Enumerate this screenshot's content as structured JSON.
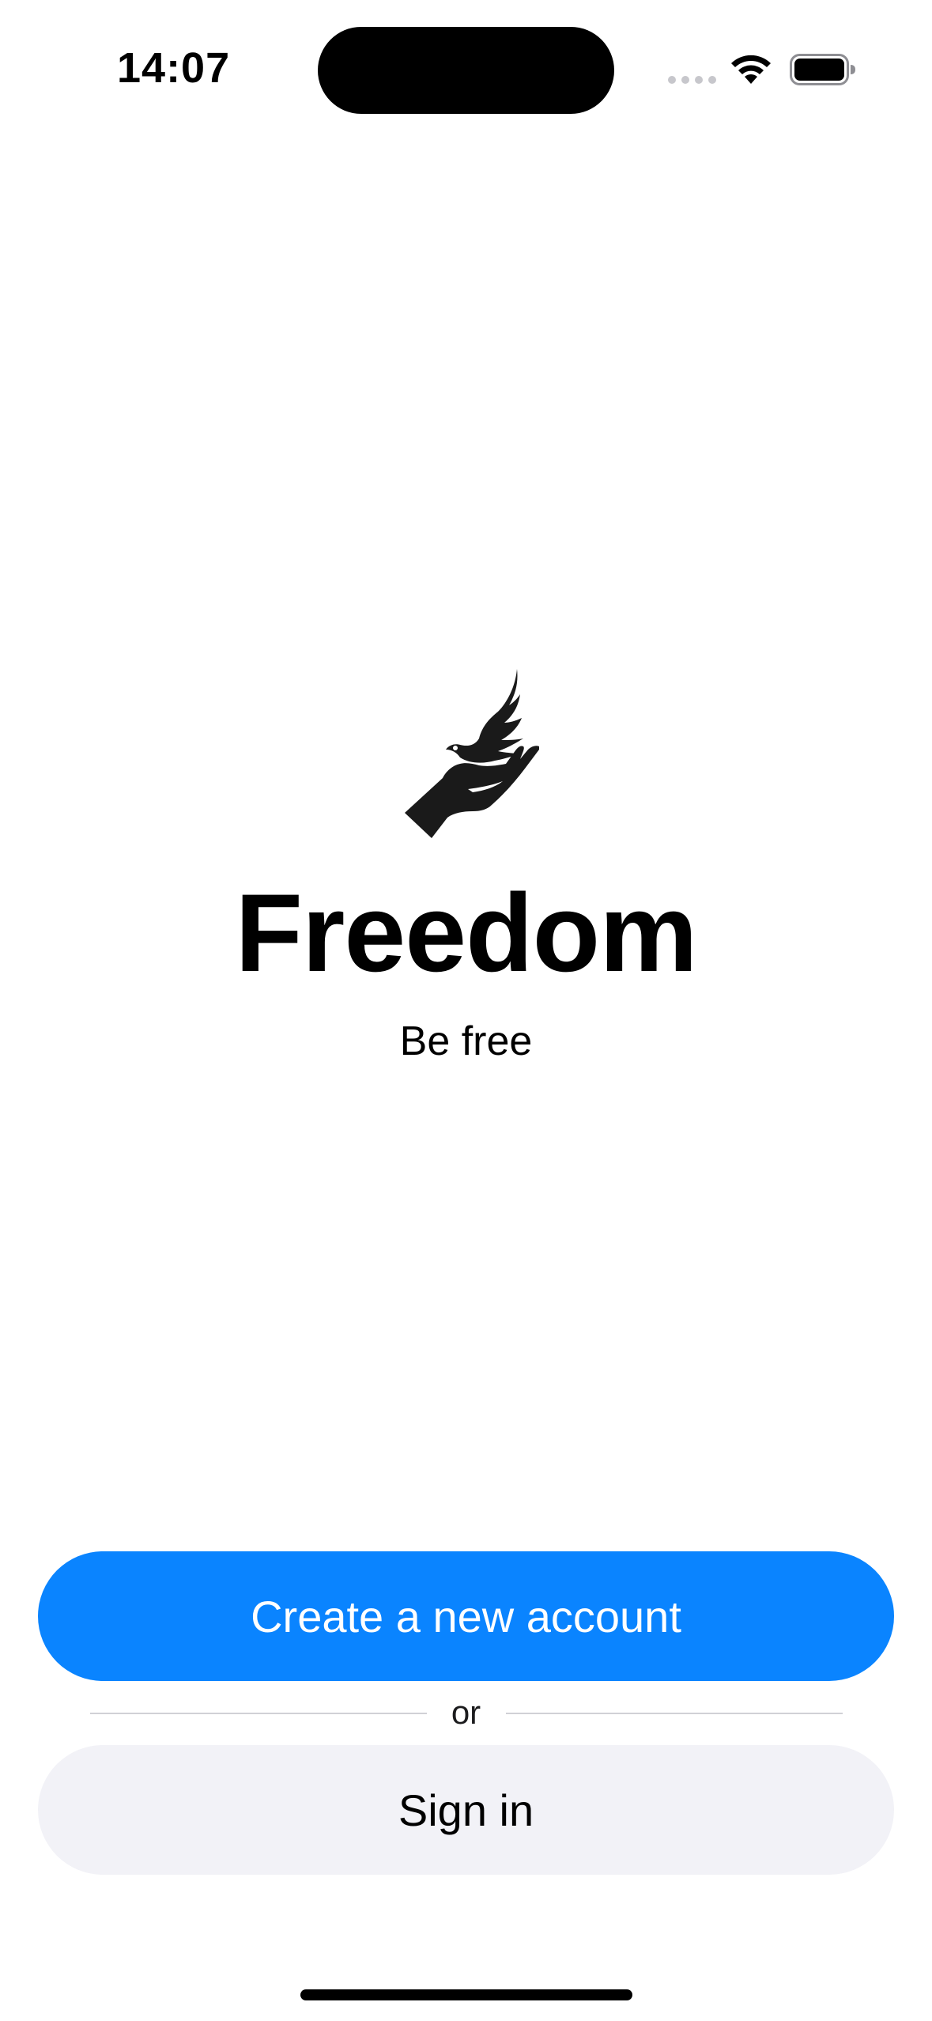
{
  "status_bar": {
    "time": "14:07",
    "icons": [
      "cellular-signal-icon",
      "wifi-icon",
      "battery-icon"
    ]
  },
  "hero": {
    "logo_icon": "dove-in-hand-icon",
    "title": "Freedom",
    "subtitle": "Be free"
  },
  "actions": {
    "create_account_label": "Create a new account",
    "divider_text": "or",
    "sign_in_label": "Sign in"
  },
  "colors": {
    "primary": "#0a84ff",
    "secondary_bg": "#f2f2f7",
    "background": "#ffffff"
  }
}
